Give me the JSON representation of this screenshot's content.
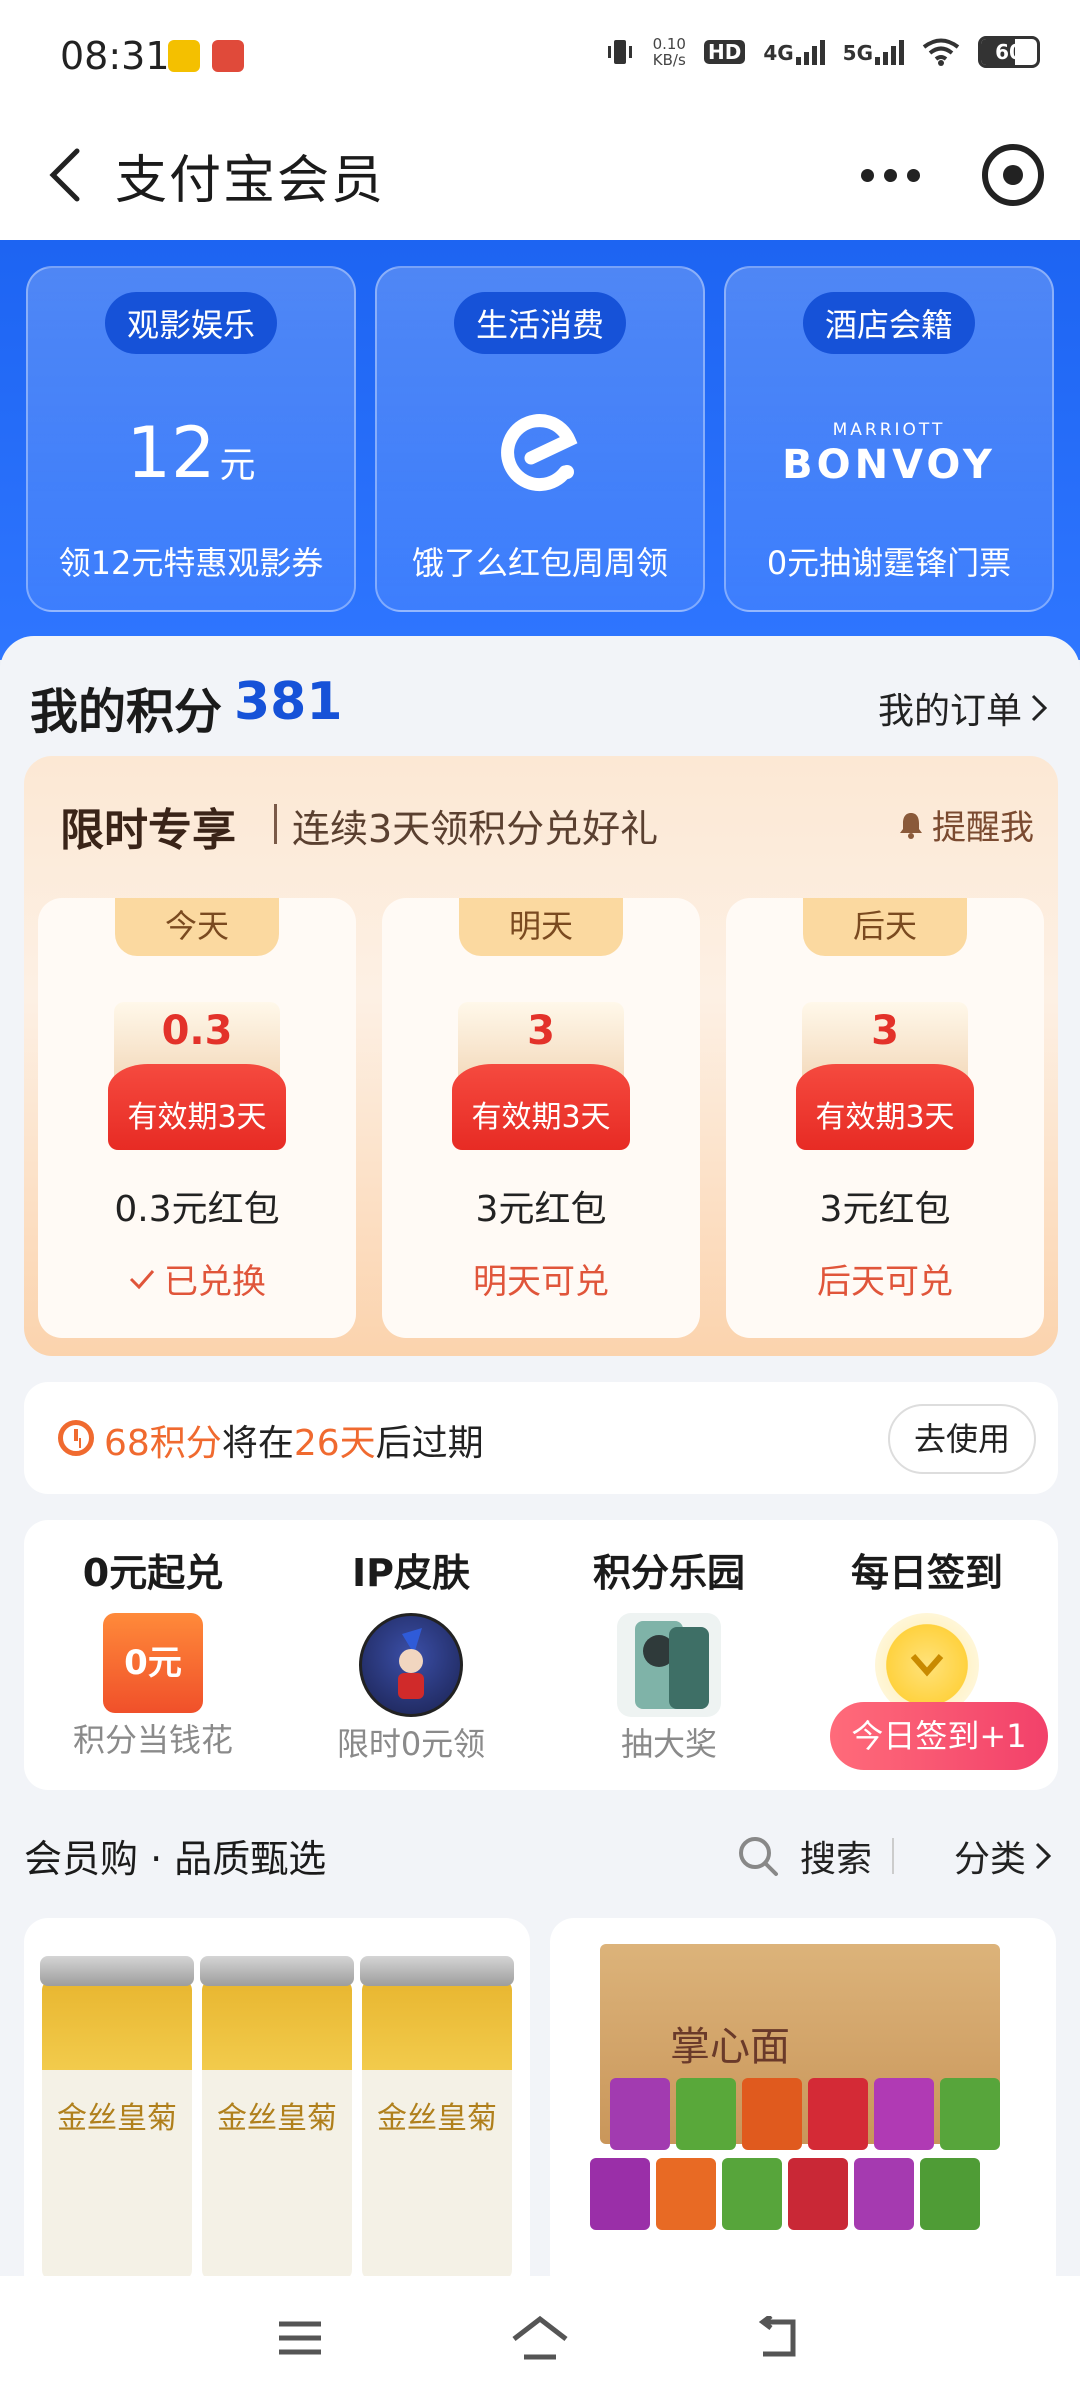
{
  "status_bar": {
    "time": "08:31",
    "net_speed_value": "0.10",
    "net_speed_unit": "KB/s",
    "hd_label": "HD",
    "sig1_label": "4G",
    "sig2_label": "5G",
    "battery": "60"
  },
  "header": {
    "title": "支付宝会员"
  },
  "banner": {
    "cards": [
      {
        "tag": "观影娱乐",
        "amount": "12",
        "unit": "元",
        "caption": "领12元特惠观影券"
      },
      {
        "tag": "生活消费",
        "caption": "饿了么红包周周领",
        "icon": "eleme-logo-icon"
      },
      {
        "tag": "酒店会籍",
        "logo_line1": "MARRIOTT",
        "logo_line2": "BONVOY",
        "caption": "0元抽谢霆锋门票"
      }
    ]
  },
  "points": {
    "title": "我的积分",
    "value": "381",
    "orders_link": "我的订单"
  },
  "limited": {
    "title": "限时专享",
    "subtitle": "连续3天领积分兑好礼",
    "remind": "提醒我",
    "days": [
      {
        "tag": "今天",
        "value": "0.3",
        "validity": "有效期3天",
        "name": "0.3元红包",
        "status": "已兑换",
        "redeemed": true
      },
      {
        "tag": "明天",
        "value": "3",
        "validity": "有效期3天",
        "name": "3元红包",
        "status": "明天可兑",
        "redeemed": false
      },
      {
        "tag": "后天",
        "value": "3",
        "validity": "有效期3天",
        "name": "3元红包",
        "status": "后天可兑",
        "redeemed": false
      }
    ]
  },
  "expire": {
    "points": "68积分",
    "middle": "将在",
    "days": "26天",
    "suffix": "后过期",
    "button": "去使用"
  },
  "features": [
    {
      "title": "0元起兑",
      "subtitle": "积分当钱花",
      "img_text": "0元"
    },
    {
      "title": "IP皮肤",
      "subtitle": "限时0元领"
    },
    {
      "title": "积分乐园",
      "subtitle": "抽大奖"
    },
    {
      "title": "每日签到",
      "subtitle": "今日签到+1"
    }
  ],
  "shop": {
    "title": "会员购 · 品质甄选",
    "search": "搜索",
    "category": "分类",
    "product1_label": "金丝皇菊",
    "product2_label": "掌心面"
  },
  "colors": {
    "primary_blue": "#1d64f2",
    "accent_orange": "#f06a2f",
    "red_packet": "#e72b24",
    "points_blue": "#1652d8",
    "checkin_pink": "#f2416a"
  }
}
